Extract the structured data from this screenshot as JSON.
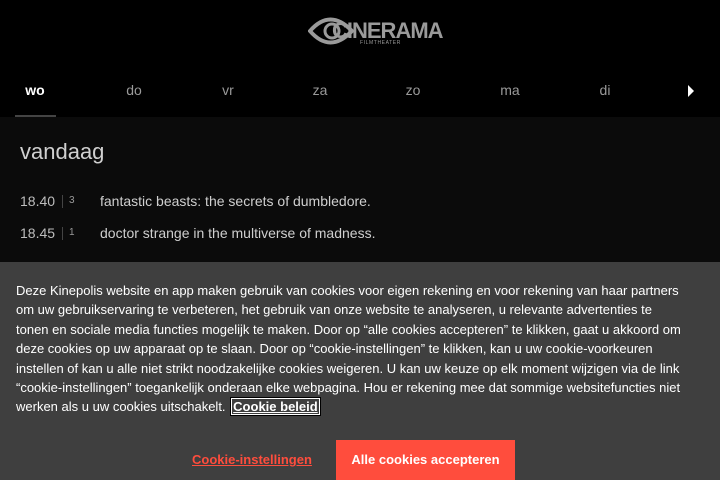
{
  "brand": {
    "logo_text": "CINERAMA",
    "logo_subtext": "FILMTHEATER"
  },
  "days": [
    {
      "label": "wo",
      "active": true
    },
    {
      "label": "do",
      "active": false
    },
    {
      "label": "vr",
      "active": false
    },
    {
      "label": "za",
      "active": false
    },
    {
      "label": "zo",
      "active": false
    },
    {
      "label": "ma",
      "active": false
    },
    {
      "label": "di",
      "active": false
    }
  ],
  "next_icon": "chevron-right-icon",
  "schedule": {
    "section_title": "vandaag",
    "shows": [
      {
        "time": "18.40",
        "room": "3",
        "title": "fantastic beasts: the secrets of dumbledore."
      },
      {
        "time": "18.45",
        "room": "1",
        "title": "doctor strange in the multiverse of madness."
      }
    ]
  },
  "cookie_banner": {
    "text": "Deze Kinepolis website en app maken gebruik van cookies voor eigen rekening en voor rekening van haar partners om uw gebruikservaring te verbeteren, het gebruik van onze website te analyseren, u relevante advertenties te tonen en sociale media functies mogelijk te maken. Door op “alle cookies accepteren” te klikken, gaat u akkoord om deze cookies op uw apparaat op te slaan. Door op “cookie-instellingen” te klikken, kan u uw cookie-voorkeuren instellen of kan u alle niet strikt noodzakelijke cookies weigeren. U kan uw keuze op elk moment wijzigen via de link “cookie-instellingen” toegankelijk onderaan elke webpagina. Hou er rekening mee dat sommige websitefuncties niet werken als u uw cookies uitschakelt.",
    "policy_link": "Cookie beleid",
    "settings_button": "Cookie-instellingen",
    "accept_button": "Alle cookies accepteren"
  },
  "colors": {
    "accent": "#ff4d3d",
    "banner_bg": "#3f3f3f",
    "page_bg": "#000000"
  }
}
